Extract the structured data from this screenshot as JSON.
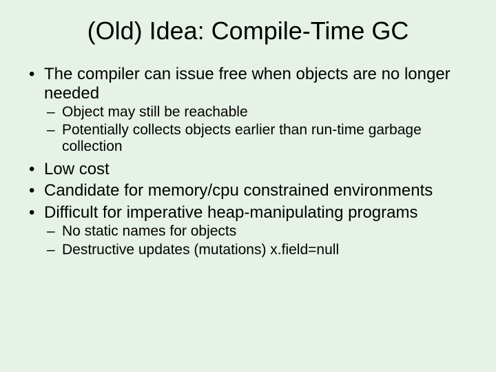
{
  "title": "(Old) Idea: Compile-Time GC",
  "bullets": [
    {
      "text": "The compiler can issue free when objects are no longer needed",
      "sub": [
        "Object may still be reachable",
        "Potentially collects objects earlier than run-time garbage collection"
      ]
    },
    {
      "text": "Low cost",
      "sub": []
    },
    {
      "text": "Candidate for memory/cpu constrained environments",
      "sub": []
    },
    {
      "text": "Difficult for imperative heap-manipulating programs",
      "sub": [
        "No static names for objects",
        "Destructive updates (mutations) x.field=null"
      ]
    }
  ]
}
